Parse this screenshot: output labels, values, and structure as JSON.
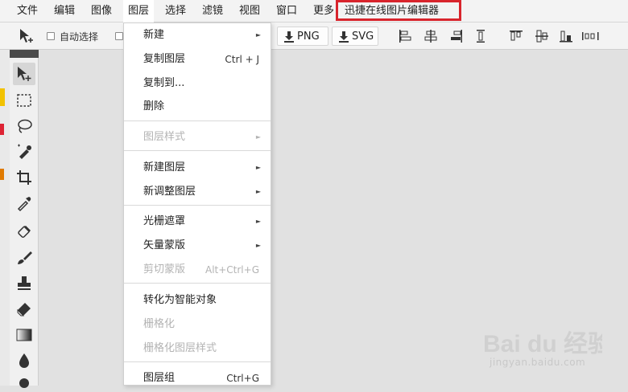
{
  "menubar": {
    "items": [
      "文件",
      "编辑",
      "图像",
      "图层",
      "选择",
      "滤镜",
      "视图",
      "窗口",
      "更多",
      "迅捷在线图片编辑器"
    ]
  },
  "options": {
    "auto_select_label": "自动选择",
    "export_png": "PNG",
    "export_svg": "SVG"
  },
  "dropdown": {
    "items": [
      {
        "label": "新建",
        "shortcut": "",
        "submenu": true,
        "disabled": false
      },
      {
        "label": "复制图层",
        "shortcut": "Ctrl + J",
        "submenu": false,
        "disabled": false
      },
      {
        "label": "复制到...",
        "shortcut": "",
        "submenu": false,
        "disabled": false
      },
      {
        "label": "删除",
        "shortcut": "",
        "submenu": false,
        "disabled": false
      },
      {
        "label": "图层样式",
        "shortcut": "",
        "submenu": true,
        "disabled": true
      },
      {
        "label": "新建图层",
        "shortcut": "",
        "submenu": true,
        "disabled": false
      },
      {
        "label": "新调整图层",
        "shortcut": "",
        "submenu": true,
        "disabled": false
      },
      {
        "label": "光栅遮罩",
        "shortcut": "",
        "submenu": true,
        "disabled": false
      },
      {
        "label": "矢量蒙版",
        "shortcut": "",
        "submenu": true,
        "disabled": false
      },
      {
        "label": "剪切蒙版",
        "shortcut": "Alt+Ctrl+G",
        "submenu": false,
        "disabled": true
      },
      {
        "label": "转化为智能对象",
        "shortcut": "",
        "submenu": false,
        "disabled": false
      },
      {
        "label": "栅格化",
        "shortcut": "",
        "submenu": false,
        "disabled": true
      },
      {
        "label": "栅格化图层样式",
        "shortcut": "",
        "submenu": false,
        "disabled": true
      },
      {
        "label": "图层组",
        "shortcut": "Ctrl+G",
        "submenu": false,
        "disabled": false
      }
    ]
  },
  "watermark": {
    "brand": "Bai du 经验",
    "url": "jingyan.baidu.com"
  },
  "colors": {
    "highlight": "#d8242c",
    "menubar_bg": "#f3f3f3",
    "canvas_bg": "#e1e1e1"
  },
  "icons": [
    "move-tool-icon",
    "marquee-icon",
    "lasso-icon",
    "quick-select-icon",
    "crop-icon",
    "eyedropper-icon",
    "healing-icon",
    "brush-icon",
    "stamp-icon",
    "eraser-icon",
    "gradient-icon",
    "blur-icon",
    "dodge-icon",
    "download-icon",
    "align-icon"
  ]
}
